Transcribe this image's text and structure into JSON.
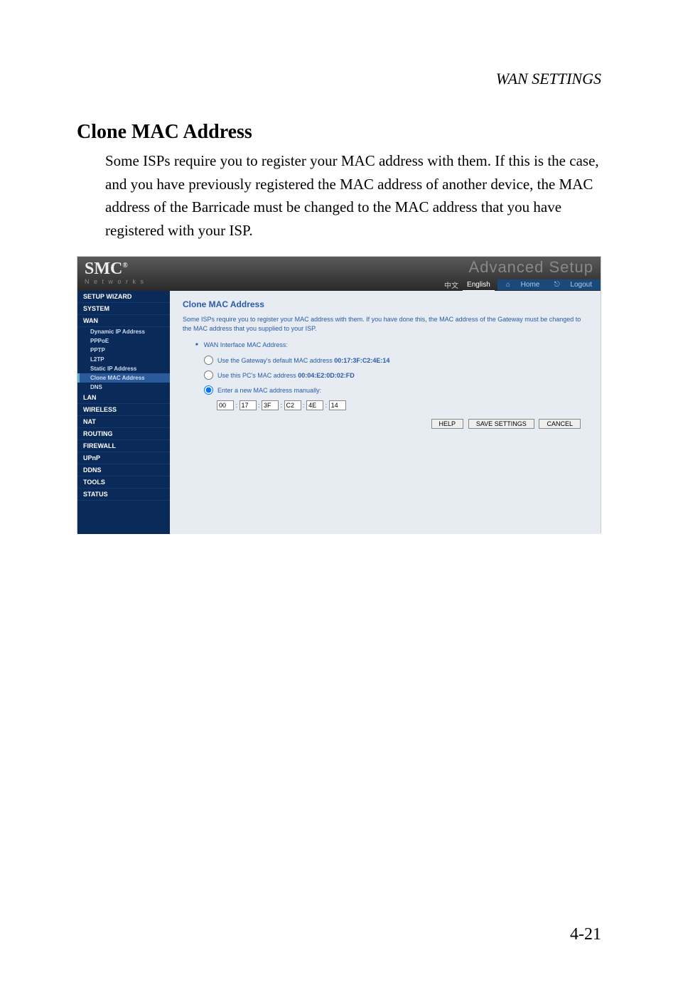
{
  "page": {
    "header": "WAN SETTINGS",
    "section_title": "Clone MAC Address",
    "body": "Some ISPs require you to register your MAC address with them. If this is the case, and you have previously registered the MAC address of another device, the MAC address of the Barricade must be changed to the MAC address that you have registered with your ISP.",
    "number": "4-21"
  },
  "app": {
    "logo": "SMC",
    "logo_reg": "®",
    "logo_sub": "N e t w o r k s",
    "title": "Advanced Setup",
    "lang_zh": "中文",
    "lang_en": "English",
    "home": "Home",
    "logout": "Logout"
  },
  "sidebar": {
    "items": [
      {
        "label": "SETUP WIZARD",
        "sub": false
      },
      {
        "label": "SYSTEM",
        "sub": false
      },
      {
        "label": "WAN",
        "sub": false
      },
      {
        "label": "Dynamic IP Address",
        "sub": true
      },
      {
        "label": "PPPoE",
        "sub": true
      },
      {
        "label": "PPTP",
        "sub": true
      },
      {
        "label": "L2TP",
        "sub": true
      },
      {
        "label": "Static IP Address",
        "sub": true
      },
      {
        "label": "Clone MAC Address",
        "sub": true,
        "active": true
      },
      {
        "label": "DNS",
        "sub": true
      },
      {
        "label": "LAN",
        "sub": false
      },
      {
        "label": "WIRELESS",
        "sub": false
      },
      {
        "label": "NAT",
        "sub": false
      },
      {
        "label": "ROUTING",
        "sub": false
      },
      {
        "label": "FIREWALL",
        "sub": false
      },
      {
        "label": "UPnP",
        "sub": false
      },
      {
        "label": "DDNS",
        "sub": false
      },
      {
        "label": "TOOLS",
        "sub": false
      },
      {
        "label": "STATUS",
        "sub": false
      }
    ]
  },
  "panel": {
    "title": "Clone MAC Address",
    "desc": "Some ISPs require you to register your MAC address with them. If you have done this, the MAC address of the Gateway must be changed to the MAC address that you supplied to your ISP.",
    "wan_label": "WAN Interface MAC Address:",
    "opt1_prefix": "Use the Gateway's default MAC address ",
    "opt1_mac": "00:17:3F:C2:4E:14",
    "opt2_prefix": "Use this PC's MAC address ",
    "opt2_mac": "00:04:E2:0D:02:FD",
    "opt3": "Enter a new MAC address manually:",
    "mac": [
      "00",
      "17",
      "3F",
      "C2",
      "4E",
      "14"
    ],
    "buttons": {
      "help": "HELP",
      "save": "SAVE SETTINGS",
      "cancel": "CANCEL"
    }
  }
}
